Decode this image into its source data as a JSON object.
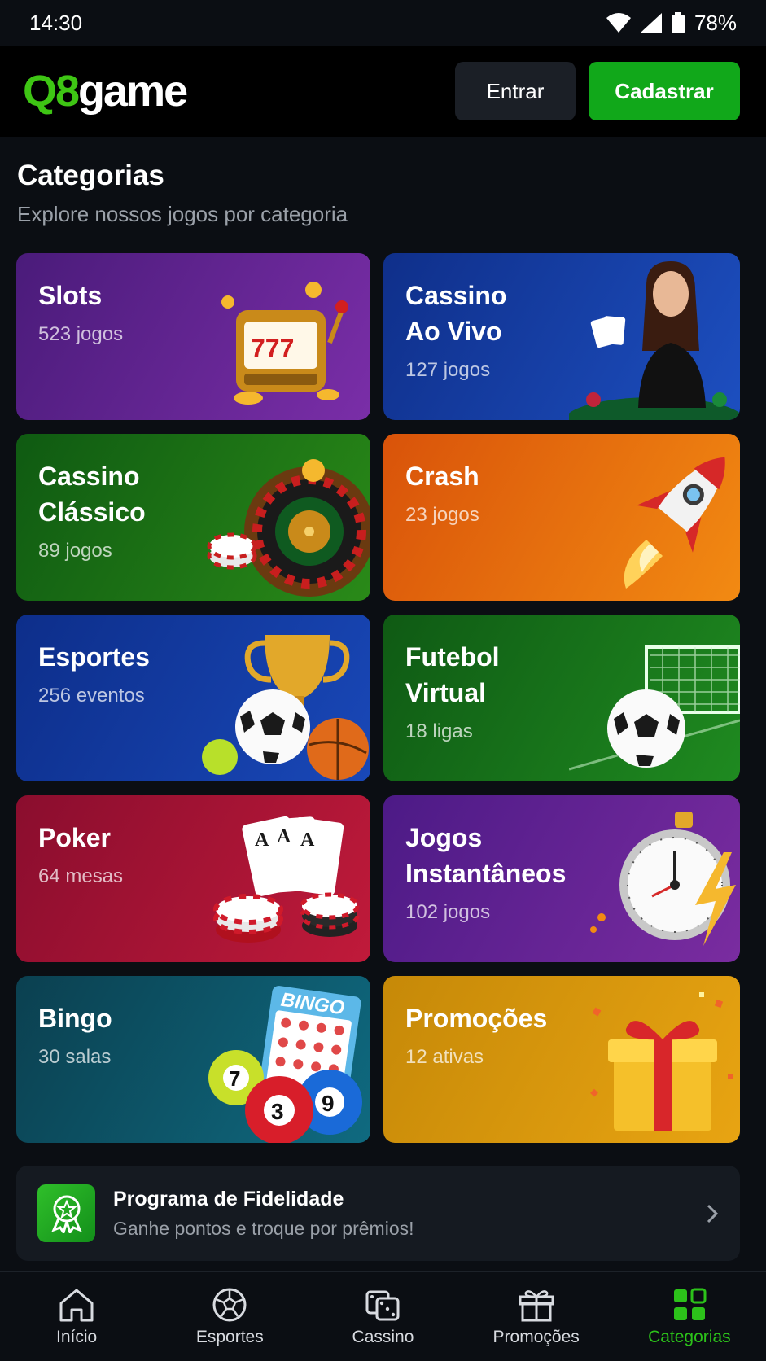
{
  "status_bar": {
    "time": "14:30",
    "battery": "78%"
  },
  "header": {
    "logo_q8": "Q8",
    "logo_game": "game",
    "login_label": "Entrar",
    "register_label": "Cadastrar"
  },
  "page": {
    "title": "Categorias",
    "subtitle": "Explore nossos jogos por categoria"
  },
  "categories": [
    {
      "title": "Slots",
      "count": "523 jogos",
      "icon": "slot-machine-icon"
    },
    {
      "title": "Cassino\nAo Vivo",
      "count": "127 jogos",
      "icon": "live-dealer-icon"
    },
    {
      "title": "Cassino\nClássico",
      "count": "89 jogos",
      "icon": "roulette-icon"
    },
    {
      "title": "Crash",
      "count": "23 jogos",
      "icon": "rocket-icon"
    },
    {
      "title": "Esportes",
      "count": "256 eventos",
      "icon": "trophy-ball-icon"
    },
    {
      "title": "Futebol\nVirtual",
      "count": "18 ligas",
      "icon": "soccer-goal-icon"
    },
    {
      "title": "Poker",
      "count": "64 mesas",
      "icon": "cards-chips-icon"
    },
    {
      "title": "Jogos\nInstantâneos",
      "count": "102 jogos",
      "icon": "stopwatch-icon"
    },
    {
      "title": "Bingo",
      "count": "30 salas",
      "icon": "bingo-icon",
      "bingo_card": "BINGO",
      "balls": [
        "7",
        "3",
        "9"
      ]
    },
    {
      "title": "Promoções",
      "count": "12 ativas",
      "icon": "gift-icon"
    }
  ],
  "loyalty": {
    "title": "Programa de Fidelidade",
    "subtitle": "Ganhe pontos e troque por prêmios!"
  },
  "bottom_nav": [
    {
      "label": "Início",
      "icon": "home-icon"
    },
    {
      "label": "Esportes",
      "icon": "soccer-ball-icon"
    },
    {
      "label": "Cassino",
      "icon": "dice-icon"
    },
    {
      "label": "Promoções",
      "icon": "gift-icon"
    },
    {
      "label": "Categorias",
      "icon": "grid-icon",
      "active": true
    }
  ],
  "colors": {
    "accent_green": "#11a81a",
    "logo_green": "#3ec514",
    "active_nav": "#2cc21a",
    "background": "#0b0e13"
  }
}
